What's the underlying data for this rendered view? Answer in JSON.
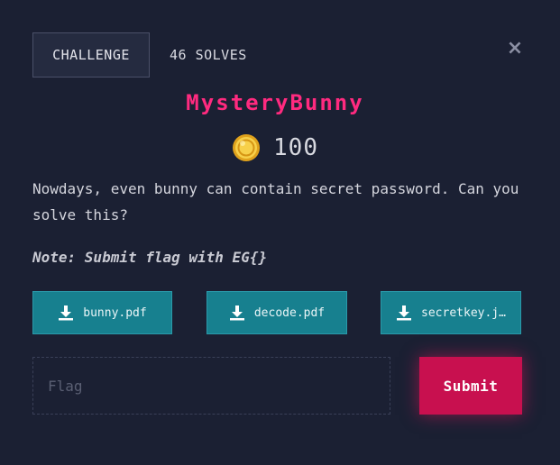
{
  "tabs": {
    "challenge_label": "CHALLENGE",
    "solves_label": "46 SOLVES"
  },
  "close_label": "×",
  "challenge": {
    "title": "MysteryBunny",
    "points": "100",
    "description": "Nowdays, even bunny can contain secret password. Can you solve this?",
    "note": "Note: Submit flag with EG{}"
  },
  "files": [
    {
      "label": "bunny.pdf",
      "icon": "download-icon"
    },
    {
      "label": "decode.pdf",
      "icon": "download-icon"
    },
    {
      "label": "secretkey.j…",
      "icon": "download-icon"
    }
  ],
  "flag_form": {
    "placeholder": "Flag",
    "value": "",
    "submit_label": "Submit"
  },
  "colors": {
    "background": "#1b2033",
    "title": "#ff2a7f",
    "file_button": "#17808f",
    "submit_button": "#c8104f",
    "coin": "#f2c530"
  }
}
